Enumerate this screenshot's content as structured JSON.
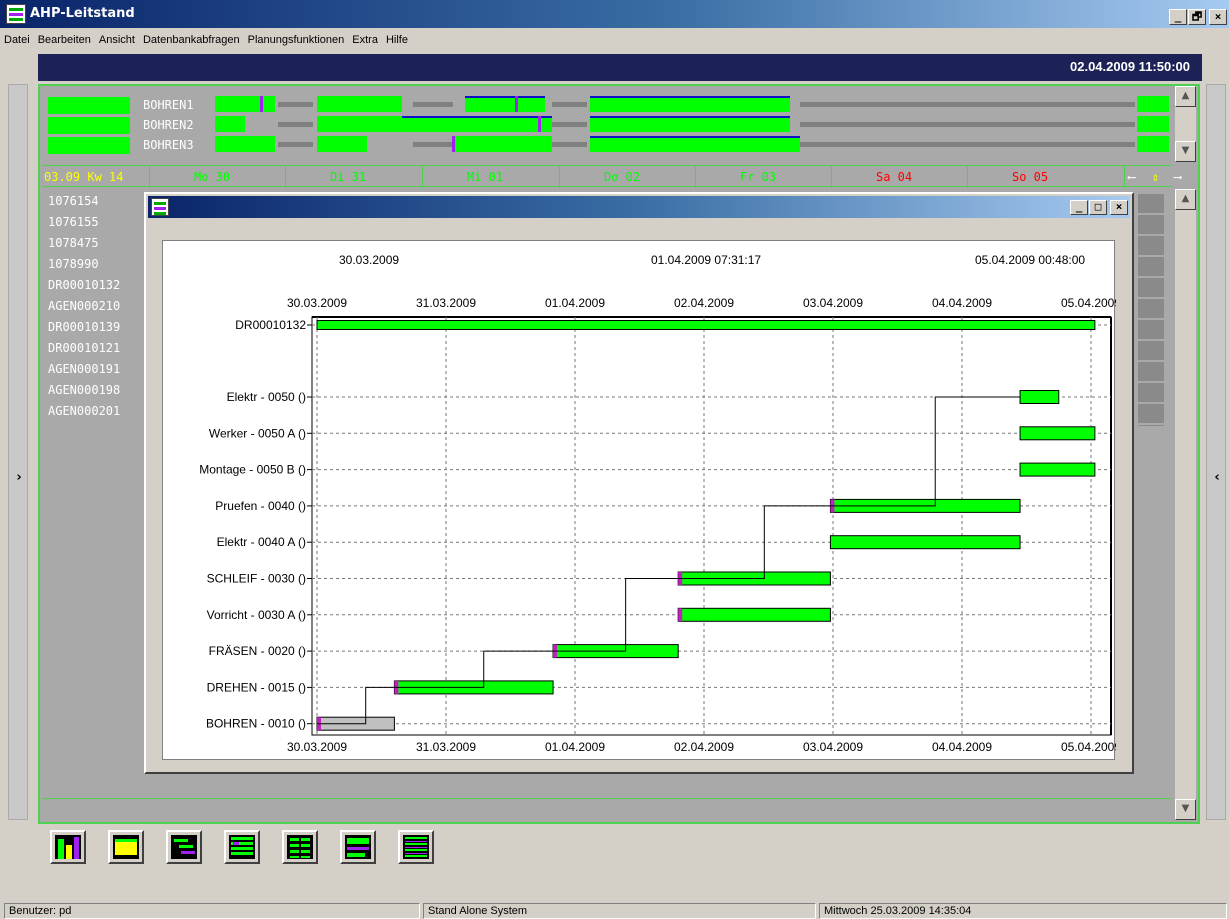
{
  "window": {
    "title": "AHP-Leitstand",
    "controls": [
      "_",
      "🗗",
      "×"
    ]
  },
  "menu": [
    "Datei",
    "Bearbeiten",
    "Ansicht",
    "Datenbankabfragen",
    "Planungsfunktionen",
    "Extra",
    "Hilfe"
  ],
  "header_datetime": "02.04.2009 11:50:00",
  "side_left_arrow": "›",
  "side_right_arrow": "‹",
  "resources": [
    {
      "label": "BOHREN1"
    },
    {
      "label": "BOHREN2"
    },
    {
      "label": "BOHREN3"
    }
  ],
  "week_label": "03.09 Kw 14",
  "days": [
    {
      "label": "Mo 30",
      "weekend": false
    },
    {
      "label": "Di 31",
      "weekend": false
    },
    {
      "label": "Mi 01",
      "weekend": false
    },
    {
      "label": "Do 02",
      "weekend": false
    },
    {
      "label": "Fr 03",
      "weekend": false
    },
    {
      "label": "Sa 04",
      "weekend": true
    },
    {
      "label": "So 05",
      "weekend": true
    }
  ],
  "nav_arrows": {
    "left": "⟵",
    "middle": "⇕",
    "right": "⟶"
  },
  "orders": [
    "1076154",
    "1076155",
    "1078475",
    "1078990",
    "DR00010132",
    "AGEN000210",
    "DR00010139",
    "DR00010121",
    "AGEN000191",
    "AGEN000198",
    "AGEN000201"
  ],
  "subwindow": {
    "controls": [
      "_",
      "□",
      "×"
    ]
  },
  "chart_data": {
    "type": "gantt",
    "header_left": "30.03.2009",
    "header_center": "01.04.2009 07:31:17",
    "header_right": "05.04.2009 00:48:00",
    "x_ticks": [
      "30.03.2009",
      "31.03.2009",
      "01.04.2009",
      "02.04.2009",
      "03.04.2009",
      "04.04.2009",
      "05.04.2009"
    ],
    "x_range_days": [
      0,
      6.2
    ],
    "rows": [
      {
        "label": "DR00010132",
        "start": 0.0,
        "end": 6.03,
        "color": "#00ff00",
        "type": "order"
      },
      {
        "label": "Elektr - 0050   ()",
        "start": 5.45,
        "end": 5.75,
        "color": "#00ff00"
      },
      {
        "label": "Werker - 0050  A  ()",
        "start": 5.45,
        "end": 6.03,
        "color": "#00ff00"
      },
      {
        "label": "Montage - 0050  B  ()",
        "start": 5.45,
        "end": 6.03,
        "color": "#00ff00"
      },
      {
        "label": "Pruefen - 0040   ()",
        "start": 3.98,
        "end": 5.45,
        "color": "#00ff00"
      },
      {
        "label": "Elektr - 0040  A  ()",
        "start": 3.98,
        "end": 5.45,
        "color": "#00ff00"
      },
      {
        "label": "SCHLEIF - 0030   ()",
        "start": 2.8,
        "end": 3.98,
        "color": "#00ff00"
      },
      {
        "label": "Vorricht - 0030  A  ()",
        "start": 2.8,
        "end": 3.98,
        "color": "#00ff00"
      },
      {
        "label": "FRÄSEN - 0020   ()",
        "start": 1.83,
        "end": 2.8,
        "color": "#00ff00"
      },
      {
        "label": "DREHEN - 0015   ()",
        "start": 0.6,
        "end": 1.83,
        "color": "#00ff00"
      },
      {
        "label": "BOHREN - 0010   ()",
        "start": 0.0,
        "end": 0.6,
        "color": "#c0c0c0"
      }
    ]
  },
  "toolbar_buttons": [
    "chart-view",
    "yellow-view",
    "list-view",
    "gantt-view",
    "table-view",
    "plan-view",
    "detail-view"
  ],
  "status": {
    "user": "Benutzer: pd",
    "system": "Stand Alone System",
    "datetime": "Mittwoch 25.03.2009 14:35:04"
  }
}
